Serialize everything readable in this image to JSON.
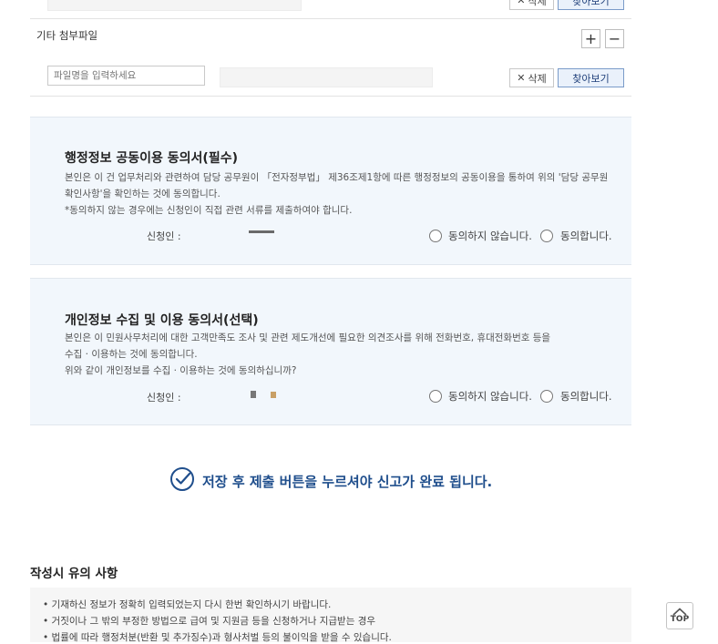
{
  "attach_top": {
    "delete_label": "삭제",
    "find_label": "찾아보기"
  },
  "other_attach": {
    "title": "기타 첨부파일",
    "add_label": "+",
    "remove_label": "−",
    "filename_placeholder": "파일명을 입력하세요",
    "delete_label": "삭제",
    "find_label": "찾아보기"
  },
  "admin_consent": {
    "title": "행정정보 공동이용 동의서(필수)",
    "line1": "본인은 이 건 업무처리와 관련하여 담당 공무원이 「전자정부법」 제36조제1항에 따른 행정정보의 공동이용을 통하여 위의 '담당 공무원",
    "line2": "확인사항'을 확인하는 것에 동의합니다.",
    "line3": "*동의하지 않는 경우에는 신청인이 직접 관련 서류를 제출하여야 합니다.",
    "signer_label": "신청인 :",
    "disagree_label": "동의하지 않습니다.",
    "agree_label": "동의합니다."
  },
  "privacy_consent": {
    "title": "개인정보 수집 및 이용 동의서(선택)",
    "line1": "본인은 이 민원사무처리에 대한 고객만족도 조사 및 관련 제도개선에 필요한 의견조사를 위해 전화번호, 휴대전화번호 등을",
    "line2": "수집 · 이용하는 것에 동의합니다.",
    "line3": "위와 같이 개인정보를 수집 · 이용하는 것에 동의하십니까?",
    "signer_label": "신청인 :",
    "disagree_label": "동의하지 않습니다.",
    "agree_label": "동의합니다."
  },
  "submit_notice": "저장 후 제출 버튼을 누르셔야 신고가 완료 됩니다.",
  "caution": {
    "title": "작성시 유의 사항",
    "items": [
      "기재하신 정보가 정확히 입력되었는지 다시 한번 확인하시기 바랍니다.",
      "거짓이나 그 밖의 부정한 방법으로 급여 및 지원금 등을 신청하거나 지급받는 경우",
      "법률에 따라 행정처분(반환 및 추가징수)과 형사처벌 등의 불이익을 받을 수 있습니다."
    ]
  },
  "top_button": "TOP",
  "colors": {
    "section_bg": "#f2f7fc",
    "accent_blue": "#1f4e8c",
    "find_button_bg": "#eaf1fb"
  }
}
